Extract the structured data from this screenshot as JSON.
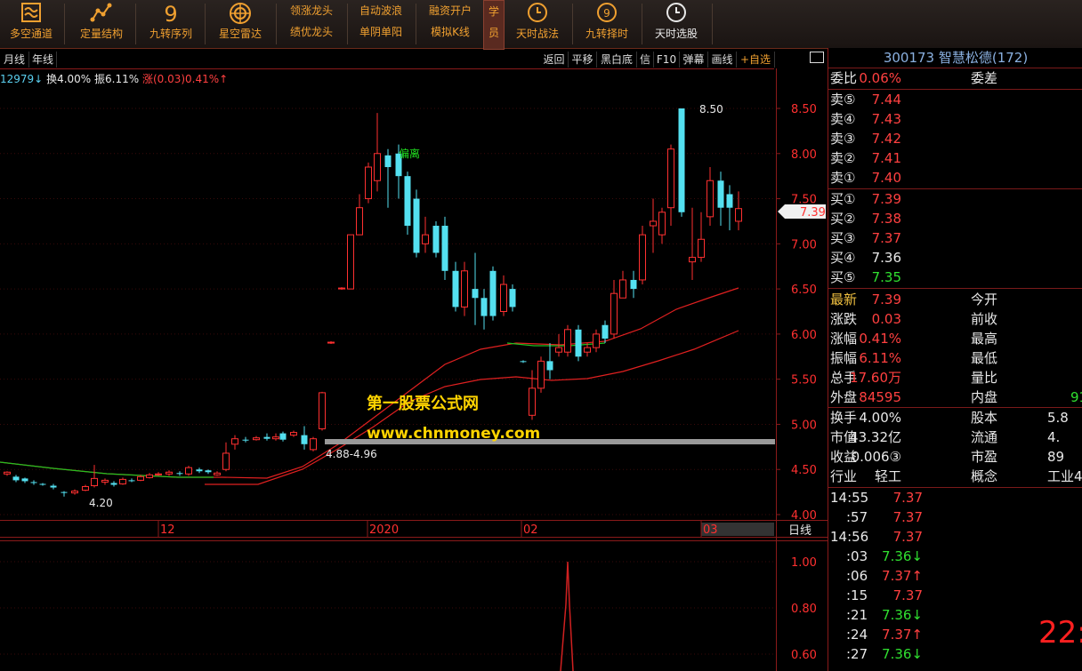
{
  "toolbar": {
    "items": [
      {
        "label": "多空通道",
        "icon": "wave-icon"
      },
      {
        "label": "定量结构",
        "icon": "scatter-icon"
      },
      {
        "label": "九转序列",
        "glyph": "9"
      },
      {
        "label": "星空雷达",
        "icon": "radar-icon"
      },
      {
        "label": "天时战法",
        "icon": "clock-icon"
      },
      {
        "label": "九转择时",
        "icon": "nine-clock-icon"
      },
      {
        "label": "天时选股",
        "icon": "clock-icon"
      }
    ],
    "double": [
      {
        "top": "领涨龙头",
        "bottom": "绩优龙头"
      },
      {
        "top": "自动波浪",
        "bottom": "单阴单阳"
      },
      {
        "top": "融资开户",
        "bottom": "模拟K线"
      }
    ],
    "learn": [
      "学",
      "员"
    ]
  },
  "chart_header": {
    "period_buttons": [
      "月线",
      "年线"
    ],
    "tools": [
      "返回",
      "平移",
      "黑白底",
      "信",
      "F10",
      "弹幕",
      "画线"
    ],
    "add_watch": "+自选",
    "info_prefix": "12979↓",
    "turnover": "换4.00%",
    "amplitude": "振6.11%",
    "change": "涨(0.03)0.41%↑"
  },
  "chart_data": {
    "type": "candlestick",
    "price_axis": [
      "8.50",
      "8.00",
      "7.50",
      "7.00",
      "6.50",
      "6.00",
      "5.50",
      "5.00",
      "4.50",
      "4.00"
    ],
    "date_labels": [
      "12",
      "2020",
      "02",
      "03"
    ],
    "period_label": "日线",
    "current_price_tag": "7.39",
    "high_label": "8.50",
    "low_label": "4.20",
    "zone_label": "4.88-4.96",
    "deviation_label": "偏离",
    "watermark_cn": "第一股票公式网",
    "watermark_url": "www.chnmoney.com",
    "sub_axis": [
      "1.00",
      "0.80",
      "0.60"
    ],
    "colors": {
      "up": "#ff3030",
      "down": "#54e0f0",
      "ma_fast": "#20c020",
      "ma": "#e02020"
    }
  },
  "quote": {
    "title": "300173 智慧松德(172)",
    "weibi_label": "委比",
    "weibi_value": "0.06%",
    "weicha_label": "委差",
    "sell": [
      {
        "label": "卖⑤",
        "price": "7.44"
      },
      {
        "label": "卖④",
        "price": "7.43"
      },
      {
        "label": "卖③",
        "price": "7.42"
      },
      {
        "label": "卖②",
        "price": "7.41"
      },
      {
        "label": "卖①",
        "price": "7.40"
      }
    ],
    "buy": [
      {
        "label": "买①",
        "price": "7.39"
      },
      {
        "label": "买②",
        "price": "7.38"
      },
      {
        "label": "买③",
        "price": "7.37"
      },
      {
        "label": "买④",
        "price": "7.36"
      },
      {
        "label": "买⑤",
        "price": "7.35"
      }
    ],
    "stats": [
      {
        "k": "最新",
        "v": "7.39",
        "k2": "今开"
      },
      {
        "k": "涨跌",
        "v": "0.03",
        "k2": "前收"
      },
      {
        "k": "涨幅",
        "v": "0.41%",
        "k2": "最高"
      },
      {
        "k": "振幅",
        "v": "6.11%",
        "k2": "最低"
      },
      {
        "k": "总手",
        "v": "17.60万",
        "k2": "量比"
      },
      {
        "k": "外盘",
        "v": "84595",
        "k2": "内盘",
        "v2": "91"
      }
    ],
    "fund": [
      {
        "k": "换手",
        "v": "4.00%",
        "k2": "股本",
        "v2": "5.8"
      },
      {
        "k": "市值",
        "v": "43.32亿",
        "k2": "流通",
        "v2": "4."
      },
      {
        "k": "收益",
        "v": "0.006③",
        "k2": "市盈",
        "v2": "89"
      },
      {
        "k": "行业",
        "v": "轻工",
        "k2": "概念",
        "v2": "工业4"
      }
    ],
    "ticks": [
      {
        "t": "14:55",
        "p": "7.37"
      },
      {
        "t": ":57",
        "p": "7.37"
      },
      {
        "t": "14:56",
        "p": "7.37"
      },
      {
        "t": ":03",
        "p": "7.36↓"
      },
      {
        "t": ":06",
        "p": "7.37↑"
      },
      {
        "t": ":15",
        "p": "7.37"
      },
      {
        "t": ":21",
        "p": "7.36↓"
      },
      {
        "t": ":24",
        "p": "7.37↑"
      },
      {
        "t": ":27",
        "p": "7.36↓"
      }
    ],
    "clock": "22:"
  }
}
